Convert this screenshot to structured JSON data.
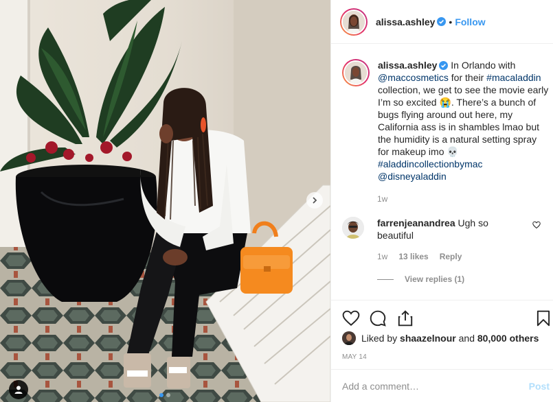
{
  "post": {
    "username": "alissa.ashley",
    "follow_label": "Follow",
    "separator": "•"
  },
  "caption": {
    "username": "alissa.ashley",
    "text_1": "In Orlando with ",
    "mention_1": "@maccosmetics",
    "text_2": " for their ",
    "hashtag_1": "#macaladdin",
    "text_3": " collection, we get to see the movie early I’m so excited 😭. There’s a bunch of bugs flying around out here, my California ass is in shambles lmao but the humidity is a natural setting spray for makeup imo 💀 ",
    "hashtag_2": "#aladdincollectionbymac",
    "mention_2": "@disneyaladdin",
    "time": "1w"
  },
  "comment": {
    "username": "farrenjeanandrea",
    "text": "Ugh so beautiful",
    "time": "1w",
    "likes": "13 likes",
    "reply_label": "Reply",
    "view_replies": "View replies (1)"
  },
  "likes": {
    "prefix": "Liked by",
    "user": "shaazelnour",
    "connector": "and",
    "others": "80,000 others"
  },
  "date": "MAY 14",
  "add_comment": {
    "placeholder": "Add a comment…",
    "post_label": "Post"
  },
  "carousel": {
    "slides": 2,
    "active": 1
  },
  "colors": {
    "link": "#3897f0",
    "verified": "#3897f0",
    "post_disabled": "#b2dffc"
  },
  "icons": [
    "verified-icon",
    "heart-icon",
    "comment-icon",
    "share-icon",
    "bookmark-icon",
    "chevron-right-icon",
    "user-tag-icon"
  ]
}
